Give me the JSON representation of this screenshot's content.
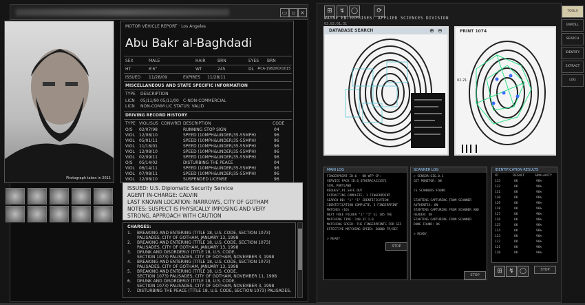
{
  "window": {
    "close": "×",
    "maximize": "▫"
  },
  "photo": {
    "caption": "Photograph taken in 2011"
  },
  "record": {
    "header": "MOTOR VEHICLE REPORT · Los Angeles",
    "name": "Abu Bakr al-Baghdadi",
    "sex_label": "SEX",
    "sex": "MALE",
    "hair_label": "HAIR",
    "hair": "BRN",
    "eyes_label": "EYES",
    "eyes": "BRN",
    "ht_label": "HT",
    "ht": "6'6\"",
    "wt_label": "WT",
    "wt": "245",
    "dl_label": "DL",
    "dl": "#CA-1982X0X1015",
    "issued_label": "ISSUED",
    "issued": "11/28/09",
    "expires_label": "EXPIRES",
    "expires": "11/28/11",
    "misc_title": "MISCELLANEOUS AND STATE SPECIFIC INFORMATION",
    "type_label": "TYPE",
    "desc_label": "DESCRIPTION",
    "lic": [
      {
        "t": "LICN",
        "d": "05/11/90 05/11/00",
        "v": "C-NON-COMMERCIAL"
      },
      {
        "t": "LICN",
        "d": "",
        "v": "NON-COMM LIC STATUS: VALID"
      }
    ],
    "history_title": "DRIVING RECORD HISTORY",
    "hist_cols": [
      "TYPE",
      "VIOL/SUS",
      "CONV/REI",
      "DESCRIPTION",
      "CODE"
    ],
    "history": [
      {
        "t": "O/S",
        "d": "02/07/98",
        "desc": "RUNNING STOP SIGN",
        "c": "04"
      },
      {
        "t": "VIOL",
        "d": "12/08/10",
        "desc": "SPEED (10MPH&UNDER/35-55MPH)",
        "c": "96"
      },
      {
        "t": "VIOL",
        "d": "05/01/11",
        "desc": "SPEED (10MPH&UNDER/35-55MPH)",
        "c": "96"
      },
      {
        "t": "VIOL",
        "d": "11/18/01",
        "desc": "SPEED (10MPH&UNDER/35-55MPH)",
        "c": "96"
      },
      {
        "t": "VIOL",
        "d": "12/08/10",
        "desc": "SPEED (10MPH&UNDER/35-55MPH)",
        "c": "96"
      },
      {
        "t": "VIOL",
        "d": "02/09/11",
        "desc": "SPEED (10MPH&UNDER/35-55MPH)",
        "c": "96"
      },
      {
        "t": "O/S",
        "d": "05/14/02",
        "desc": "DISTURBING THE PEACE",
        "c": "04"
      },
      {
        "t": "VIOL",
        "d": "06/14/11",
        "desc": "SPEED (10MPH&UNDER/35-55MPH)",
        "c": "96"
      },
      {
        "t": "VIOL",
        "d": "07/08/11",
        "desc": "SPEED (10MPH&UNDER/35-55MPH)",
        "c": "96"
      },
      {
        "t": "VIOL",
        "d": "12/08/10",
        "desc": "SUSPENDED LICENSE",
        "c": "96"
      }
    ]
  },
  "issued_box": {
    "l1": "ISSUED: U.S. Diplomatic Security Service",
    "l2": "AGENT IN-CHARGE:  CALVIN",
    "l3": "LAST KNOWN LOCATION: NARROWS, CITY OF GOTHAM",
    "l4": "NOTES: SUSPECT IS PHYSICALLY IMPOSING AND VERY",
    "l5": "STRONG, APPROACH WITH CAUTION"
  },
  "charges": {
    "title": "CHARGES:",
    "items": [
      {
        "n": "1.",
        "a": "BREAKING AND ENTERING (TITLE 18, U.S. CODE, SECTION 1073)",
        "b": "PALISADES, CITY OF GOTHAM, JANUARY 13, 1998"
      },
      {
        "n": "2.",
        "a": "BREAKING AND ENTERING (TITLE 18, U.S. CODE, SECTION 1073)",
        "b": "PALISADES, CITY OF GOTHAM, JANUARY 13, 1998"
      },
      {
        "n": "3.",
        "a": "DRUNK AND DISORDERLY (TITLE 18, U.S. CODE,",
        "b": "SECTION 1073) PALISADES, CITY OF GOTHAM, NOVEMBER 3, 1998"
      },
      {
        "n": "4.",
        "a": "BREAKING AND ENTERING (TITLE 18, U.S. CODE, SECTION 1073)",
        "b": "PALISADES, CITY OF GOTHAM, JANUARY 13, 1998"
      },
      {
        "n": "5.",
        "a": "BREAKING AND ENTERING (TITLE 18, U.S. CODE,",
        "b": "SECTION 1073) PALISADES, CITY OF GOTHAM, NOVEMBER 11, 1998"
      },
      {
        "n": "6.",
        "a": "DRUNK AND DISORDERLY (TITLE 18, U.S. CODE,",
        "b": "SECTION 1073) PALISADES, CITY OF GOTHAM, NOVEMBER 3, 1998"
      },
      {
        "n": "7.",
        "a": "DISTURBING THE PEACE (TITLE 18, U.S. CODE, SECTION 1073) PALISADES,",
        "b": ""
      }
    ]
  },
  "right": {
    "title": "WAYNE ENTERPRISES: APPLIED SCIENCES DIVISION",
    "subtitle": "03.02.01.31",
    "db_label": "DATABASE SEARCH",
    "print_label": "PRINT 1074",
    "print_code": "02.21",
    "main_log": {
      "title": "MAIN LOG",
      "lines": [
        "FINGERPRINT ID:6 · ON WFP CP:",
        "SERVICE PACK ID:6_OTHERACAJ21571",
        "SCRL_PORTLAND",
        "REQUEST_PI.SAFE.OUT",
        "EXTRACTING COMPLETE, 1 FINGERPRINT",
        "SEARCH DB: \"1\" \"1\" IDENTIFICATION",
        "IDENTIFICATION COMPLETE, 1 FINGERPRINT",
        "MATCHES (10)",
        "NEXT FREE FOLDER \"1\" \"1\" EL 185 THE",
        "MATCHING TIME: 240.32.1.0",
        "MATCHING SPEED: THE FINGERPRINTS FOR SEC",
        "EFFECTIVE MATCHING SPEED: 30000 FP/SEC",
        "",
        "> READY_"
      ],
      "stop": "STOP"
    },
    "scanner_log": {
      "title": "SCANNER LOG",
      "lines": [
        "> SENSOR:SIG.0.1",
        "GET MONITOR: ON",
        "",
        "/S SCANNERS FOUND",
        "",
        "STARTING CAPTURING FROM SCANNER",
        "AUTHENTIX: ON",
        "STARTING CAPTURING FROM SCANNER ABD",
        "HEADER: OK",
        "STARTING CAPTURING FROM SCANNER",
        "DONE FOUND: OK",
        "",
        "> READY_"
      ],
      "stop": "STOP"
    },
    "id_results": {
      "title": "IDENTIFICATION RESULTS",
      "cols": [
        "ID",
        "RESULT",
        "SIMILARITY"
      ],
      "rows": [
        [
          "133",
          "OK",
          "96%"
        ],
        [
          "132",
          "OK",
          "96%"
        ],
        [
          "131",
          "OK",
          "96%"
        ],
        [
          "130",
          "OK",
          "96%"
        ],
        [
          "129",
          "OK",
          "96%"
        ],
        [
          "128",
          "OK",
          "96%"
        ],
        [
          "127",
          "OK",
          "96%"
        ],
        [
          "126",
          "OK",
          "96%"
        ],
        [
          "125",
          "OK",
          "96%"
        ],
        [
          "124",
          "OK",
          "96%"
        ],
        [
          "123",
          "OK",
          "96%"
        ],
        [
          "122",
          "OK",
          "96%"
        ],
        [
          "121",
          "OK",
          "96%"
        ],
        [
          "120",
          "OK",
          "96%"
        ]
      ],
      "stop": "STOP"
    }
  },
  "tabs": [
    "TOOLS",
    "ENROLL",
    "SEARCH",
    "IDENTIFY",
    "EXTRACT",
    "LOG"
  ],
  "icons": {
    "grid": "⊞",
    "run": "↯",
    "circle": "◯",
    "refresh": "⟳",
    "zoom_in": "⊕",
    "zoom_out": "⊖"
  }
}
